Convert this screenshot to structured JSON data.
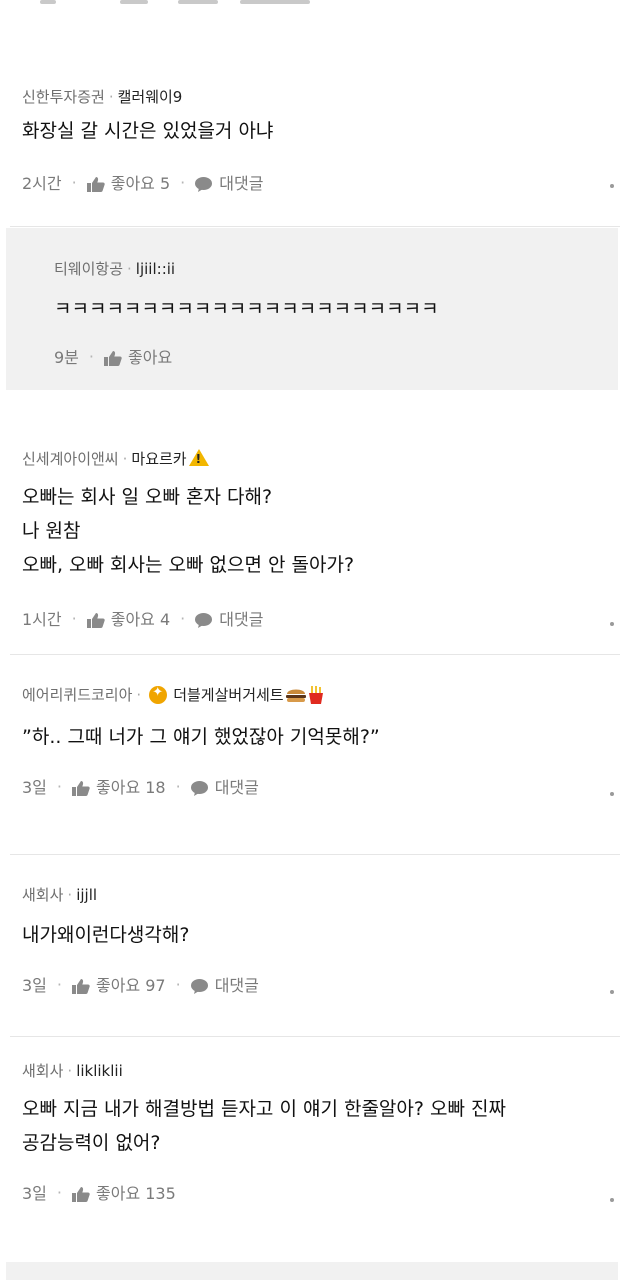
{
  "comments": [
    {
      "company": "신한투자증권",
      "user": "캘러웨이9",
      "lines": [
        "화장실 갈 시간은 있었을거 아냐"
      ],
      "time": "2시간",
      "likes": "좋아요 5",
      "reply": "대댓글"
    },
    {
      "company": "티웨이항공",
      "user": "ljiil::ii",
      "lines": [
        "ㅋㅋㅋㅋㅋㅋㅋㅋㅋㅋㅋㅋㅋㅋㅋㅋㅋㅋㅋㅋㅋㅋ"
      ],
      "time": "9분",
      "likes": "좋아요"
    },
    {
      "company": "신세계아이앤씨",
      "user": "마요르카",
      "lines": [
        "오빠는 회사 일 오빠 혼자 다해?",
        "나 원참",
        "오빠, 오빠 회사는 오빠 없으면 안 돌아가?"
      ],
      "time": "1시간",
      "likes": "좋아요 4",
      "reply": "대댓글"
    },
    {
      "company": "에어리퀴드코리아",
      "user": "더블게살버거세트",
      "lines": [
        "”하.. 그때 너가 그 얘기 했었잖아 기억못해?”"
      ],
      "time": "3일",
      "likes": "좋아요 18",
      "reply": "대댓글"
    },
    {
      "company": "새회사",
      "user": "ijjll",
      "lines": [
        "내가왜이런다생각해?"
      ],
      "time": "3일",
      "likes": "좋아요 97",
      "reply": "대댓글"
    },
    {
      "company": "새회사",
      "user": "likliklii",
      "lines": [
        "오빠 지금 내가 해결방법 듣자고 이 얘기 한줄알아? 오빠 진짜",
        "공감능력이 없어?"
      ],
      "time": "3일",
      "likes": "좋아요 135"
    }
  ],
  "icons": {
    "like": "thumbs-up-icon",
    "reply": "speech-bubble-icon",
    "more": "more-options-icon"
  },
  "colors": {
    "reply_background": "#f1f1f1",
    "meta_text": "#6f6f6f",
    "action_text": "#7a7a7a"
  }
}
